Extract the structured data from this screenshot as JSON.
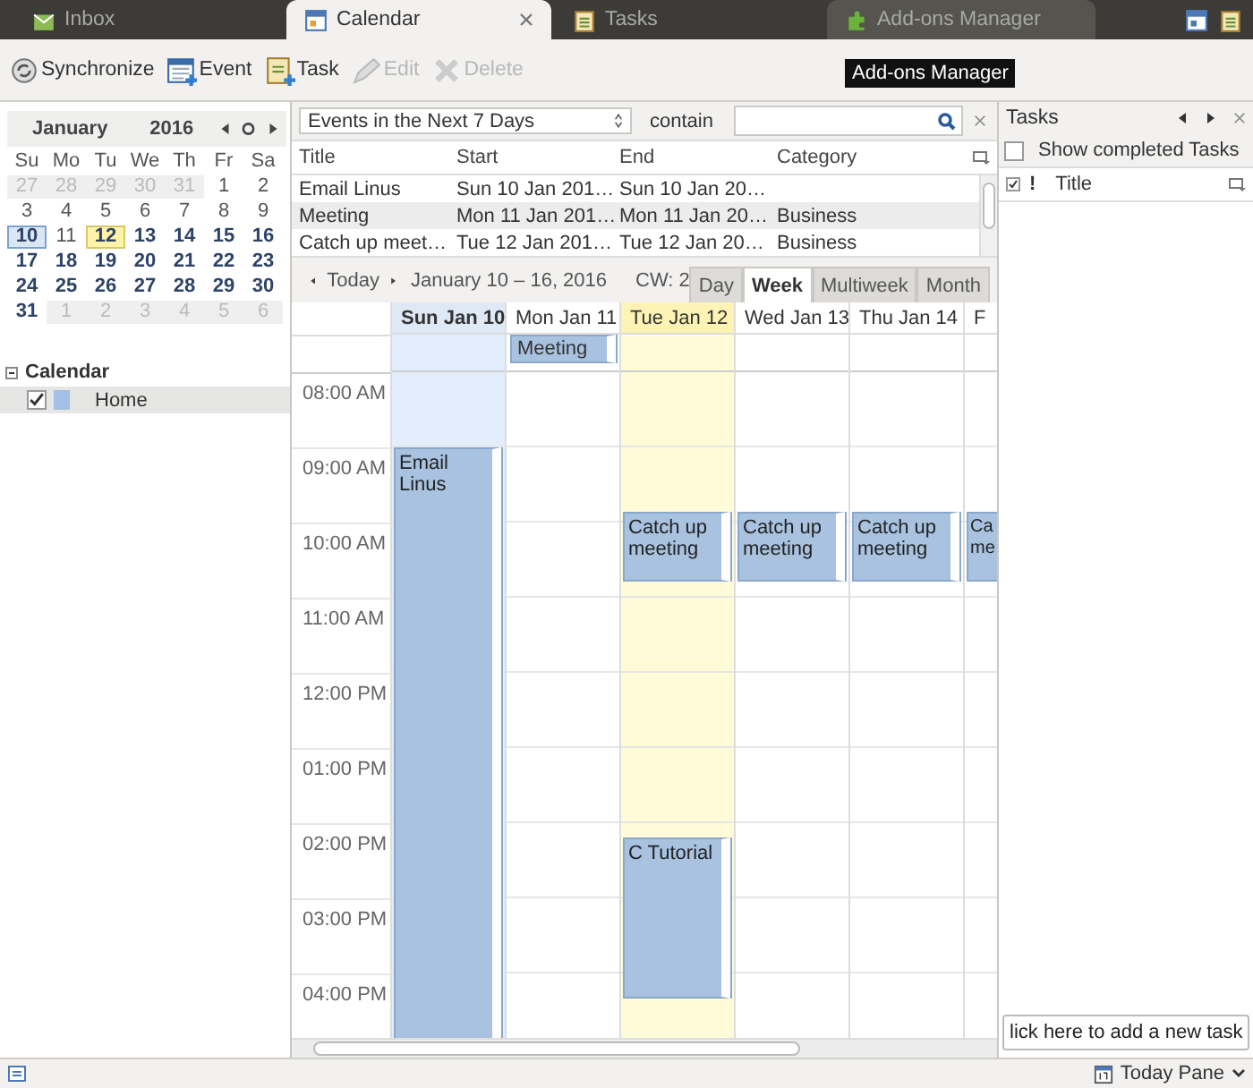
{
  "tabs": [
    {
      "label": "Inbox",
      "selected": false,
      "kind": "mail"
    },
    {
      "label": "Calendar",
      "selected": true,
      "kind": "calendar"
    },
    {
      "label": "Tasks",
      "selected": false,
      "kind": "tasks"
    },
    {
      "label": "Add-ons Manager",
      "selected": false,
      "kind": "addons"
    }
  ],
  "toolbar": [
    {
      "label": "Synchronize",
      "kind": "sync",
      "disabled": false
    },
    {
      "label": "Event",
      "kind": "event",
      "disabled": false
    },
    {
      "label": "Task",
      "kind": "task",
      "disabled": false
    },
    {
      "label": "Edit",
      "kind": "edit",
      "disabled": true
    },
    {
      "label": "Delete",
      "kind": "delete",
      "disabled": true
    }
  ],
  "tooltip": "Add-ons Manager",
  "minical": {
    "month": "January",
    "year": "2016",
    "weekdays": [
      "Su",
      "Mo",
      "Tu",
      "We",
      "Th",
      "Fr",
      "Sa"
    ],
    "weeks": [
      [
        {
          "label": "27",
          "other_month": true,
          "bold": false,
          "selected": false,
          "today": false
        },
        {
          "label": "28",
          "other_month": true,
          "bold": false,
          "selected": false,
          "today": false
        },
        {
          "label": "29",
          "other_month": true,
          "bold": false,
          "selected": false,
          "today": false
        },
        {
          "label": "30",
          "other_month": true,
          "bold": false,
          "selected": false,
          "today": false
        },
        {
          "label": "31",
          "other_month": true,
          "bold": false,
          "selected": false,
          "today": false
        },
        {
          "label": "1",
          "other_month": false,
          "bold": false,
          "selected": false,
          "today": false
        },
        {
          "label": "2",
          "other_month": false,
          "bold": false,
          "selected": false,
          "today": false
        }
      ],
      [
        {
          "label": "3",
          "other_month": false,
          "bold": false,
          "selected": false,
          "today": false
        },
        {
          "label": "4",
          "other_month": false,
          "bold": false,
          "selected": false,
          "today": false
        },
        {
          "label": "5",
          "other_month": false,
          "bold": false,
          "selected": false,
          "today": false
        },
        {
          "label": "6",
          "other_month": false,
          "bold": false,
          "selected": false,
          "today": false
        },
        {
          "label": "7",
          "other_month": false,
          "bold": false,
          "selected": false,
          "today": false
        },
        {
          "label": "8",
          "other_month": false,
          "bold": false,
          "selected": false,
          "today": false
        },
        {
          "label": "9",
          "other_month": false,
          "bold": false,
          "selected": false,
          "today": false
        }
      ],
      [
        {
          "label": "10",
          "other_month": false,
          "bold": true,
          "selected": true,
          "today": false
        },
        {
          "label": "11",
          "other_month": false,
          "bold": false,
          "selected": false,
          "today": false
        },
        {
          "label": "12",
          "other_month": false,
          "bold": true,
          "selected": false,
          "today": true
        },
        {
          "label": "13",
          "other_month": false,
          "bold": true,
          "selected": false,
          "today": false
        },
        {
          "label": "14",
          "other_month": false,
          "bold": true,
          "selected": false,
          "today": false
        },
        {
          "label": "15",
          "other_month": false,
          "bold": true,
          "selected": false,
          "today": false
        },
        {
          "label": "16",
          "other_month": false,
          "bold": true,
          "selected": false,
          "today": false
        }
      ],
      [
        {
          "label": "17",
          "other_month": false,
          "bold": true,
          "selected": false,
          "today": false
        },
        {
          "label": "18",
          "other_month": false,
          "bold": true,
          "selected": false,
          "today": false
        },
        {
          "label": "19",
          "other_month": false,
          "bold": true,
          "selected": false,
          "today": false
        },
        {
          "label": "20",
          "other_month": false,
          "bold": true,
          "selected": false,
          "today": false
        },
        {
          "label": "21",
          "other_month": false,
          "bold": true,
          "selected": false,
          "today": false
        },
        {
          "label": "22",
          "other_month": false,
          "bold": true,
          "selected": false,
          "today": false
        },
        {
          "label": "23",
          "other_month": false,
          "bold": true,
          "selected": false,
          "today": false
        }
      ],
      [
        {
          "label": "24",
          "other_month": false,
          "bold": true,
          "selected": false,
          "today": false
        },
        {
          "label": "25",
          "other_month": false,
          "bold": true,
          "selected": false,
          "today": false
        },
        {
          "label": "26",
          "other_month": false,
          "bold": true,
          "selected": false,
          "today": false
        },
        {
          "label": "27",
          "other_month": false,
          "bold": true,
          "selected": false,
          "today": false
        },
        {
          "label": "28",
          "other_month": false,
          "bold": true,
          "selected": false,
          "today": false
        },
        {
          "label": "29",
          "other_month": false,
          "bold": true,
          "selected": false,
          "today": false
        },
        {
          "label": "30",
          "other_month": false,
          "bold": true,
          "selected": false,
          "today": false
        }
      ],
      [
        {
          "label": "31",
          "other_month": false,
          "bold": true,
          "selected": false,
          "today": false
        },
        {
          "label": "1",
          "other_month": true,
          "bold": false,
          "selected": false,
          "today": false
        },
        {
          "label": "2",
          "other_month": true,
          "bold": false,
          "selected": false,
          "today": false
        },
        {
          "label": "3",
          "other_month": true,
          "bold": false,
          "selected": false,
          "today": false
        },
        {
          "label": "4",
          "other_month": true,
          "bold": false,
          "selected": false,
          "today": false
        },
        {
          "label": "5",
          "other_month": true,
          "bold": false,
          "selected": false,
          "today": false
        },
        {
          "label": "6",
          "other_month": true,
          "bold": false,
          "selected": false,
          "today": false
        }
      ]
    ]
  },
  "calendars": {
    "title": "Calendar",
    "expanded": true,
    "items": [
      {
        "name": "Home",
        "checked": true,
        "color": "#a4c0e4"
      }
    ]
  },
  "filter": {
    "range": "Events in the Next 7 Days",
    "label": "contain"
  },
  "event_list": {
    "columns": [
      "Title",
      "Start",
      "End",
      "Category"
    ],
    "rows": [
      {
        "title": "Email Linus",
        "start": "Sun 10 Jan 201…",
        "end": "Sun 10 Jan 20…",
        "category": ""
      },
      {
        "title": "Meeting",
        "start": "Mon 11 Jan 201…",
        "end": "Mon 11 Jan 20…",
        "category": "Business"
      },
      {
        "title": "Catch up meet…",
        "start": "Tue 12 Jan 201…",
        "end": "Tue 12 Jan 20…",
        "category": "Business"
      }
    ]
  },
  "nav": {
    "today": "Today",
    "range": "January 10 – 16, 2016",
    "week": "CW: 2",
    "views": [
      {
        "label": "Day",
        "selected": false
      },
      {
        "label": "Week",
        "selected": true
      },
      {
        "label": "Multiweek",
        "selected": false
      },
      {
        "label": "Month",
        "selected": false
      }
    ]
  },
  "hours": [
    "08:00 AM",
    "09:00 AM",
    "10:00 AM",
    "11:00 AM",
    "12:00 PM",
    "01:00 PM",
    "02:00 PM",
    "03:00 PM",
    "04:00 PM"
  ],
  "days": [
    {
      "label": "Sun Jan 10",
      "selected": true,
      "today": false,
      "events": [
        {
          "title": "Email Linus"
        }
      ]
    },
    {
      "label": "Mon Jan 11",
      "selected": false,
      "today": false,
      "all_day": [
        "Meeting"
      ]
    },
    {
      "label": "Tue Jan 12",
      "selected": false,
      "today": true,
      "events": [
        {
          "title": "Catch up meeting"
        },
        {
          "title": "C Tutorial"
        }
      ]
    },
    {
      "label": "Wed Jan 13",
      "selected": false,
      "today": false,
      "events": [
        {
          "title": "Catch up meeting"
        }
      ]
    },
    {
      "label": "Thu Jan 14",
      "selected": false,
      "today": false,
      "events": [
        {
          "title": "Catch up meeting"
        }
      ]
    },
    {
      "label": "F",
      "selected": false,
      "today": false,
      "events": [
        {
          "title": "Ca me"
        }
      ]
    }
  ],
  "tasks": {
    "title": "Tasks",
    "show_completed": {
      "label": "Show completed Tasks",
      "checked": false
    },
    "columns": [
      "!",
      "Title"
    ],
    "new_task": "lick here to add a new task"
  },
  "status": {
    "today_pane": "Today Pane"
  }
}
